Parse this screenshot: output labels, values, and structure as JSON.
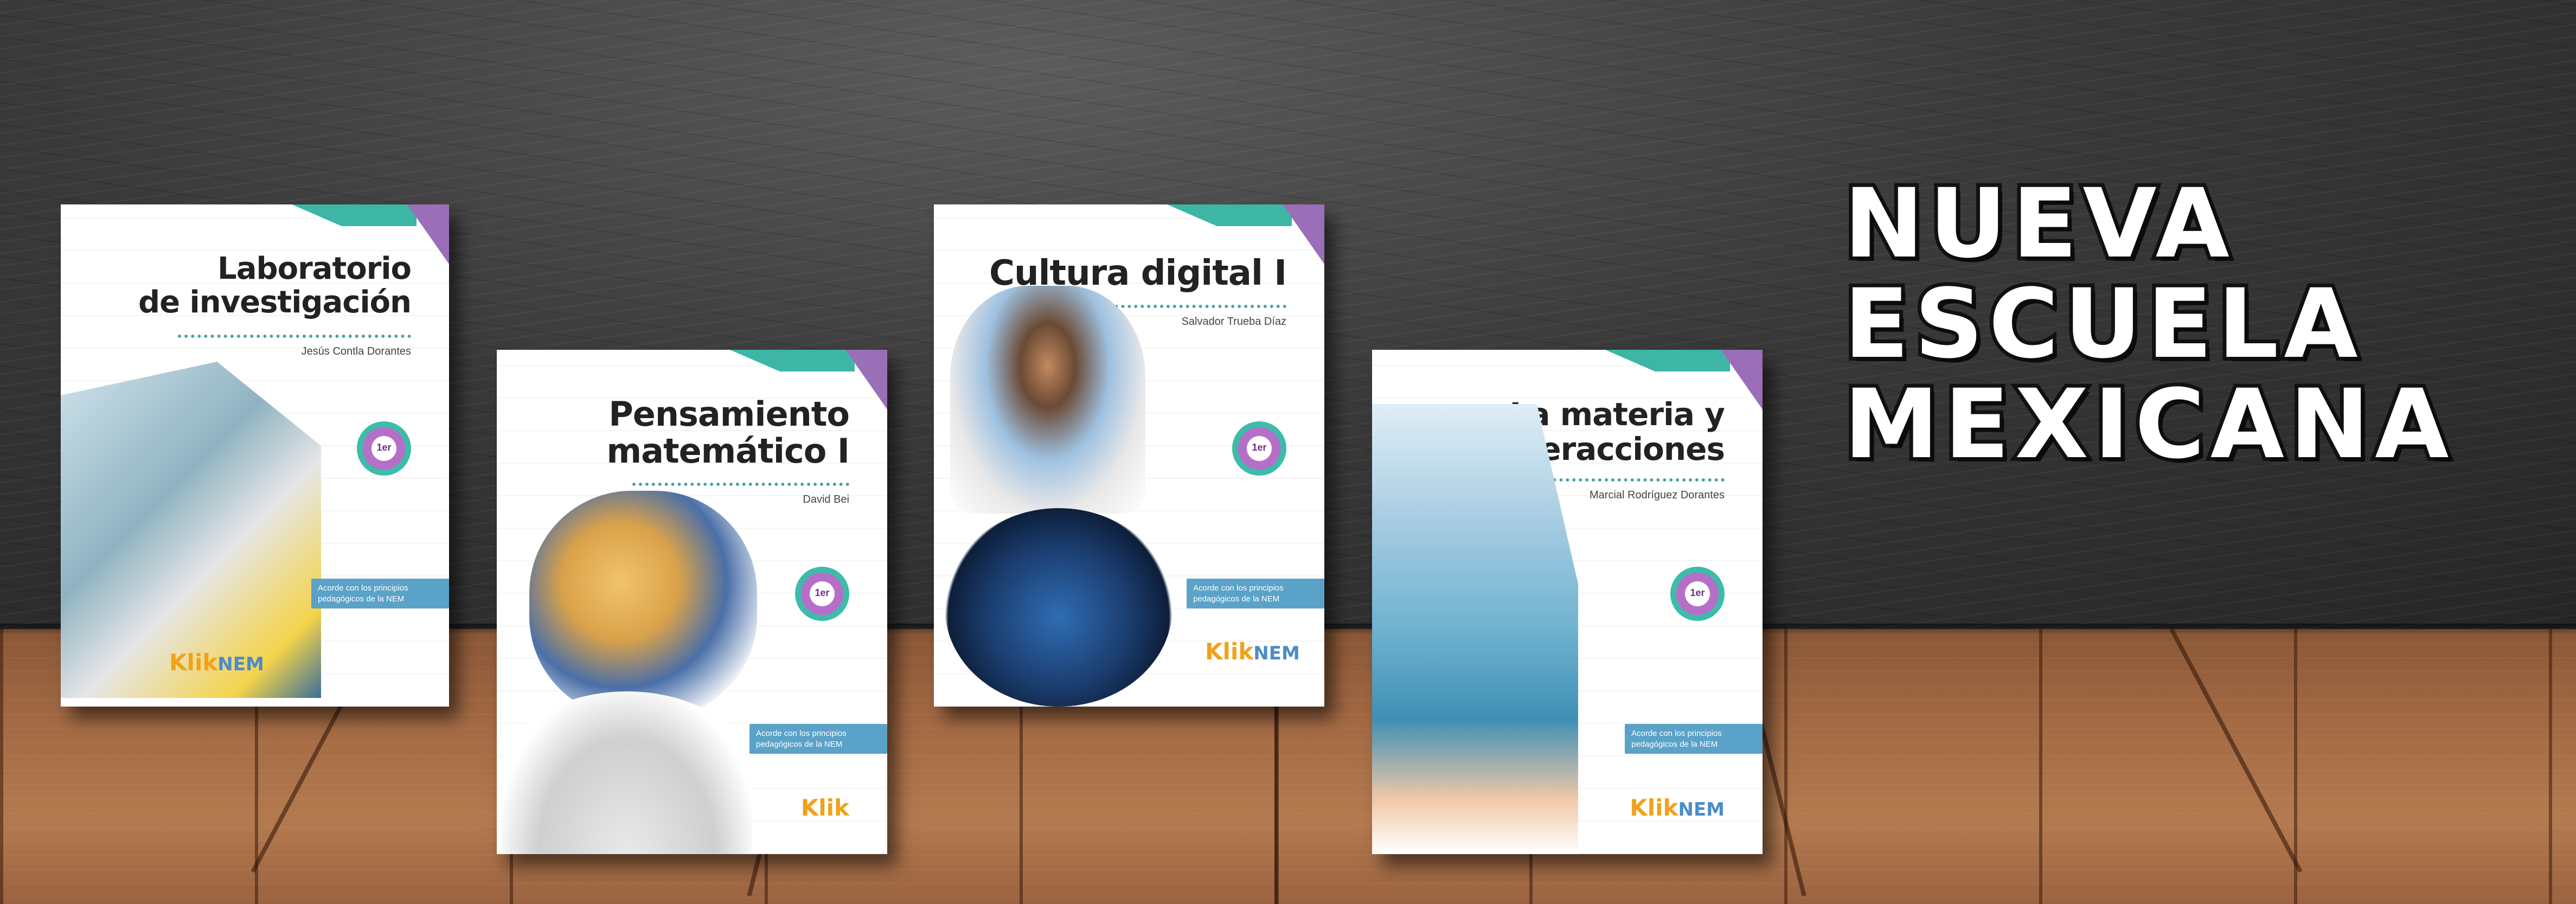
{
  "headline": {
    "line1": "NUEVA",
    "line2": "ESCUELA",
    "line3": "MEXICANA"
  },
  "books": [
    {
      "title_line1": "Laboratorio",
      "title_line2": "de investigación",
      "author": "Jesús Contla Dorantes",
      "badge": "1er",
      "nem_note": "Acorde con los principios pedagógicos de la NEM",
      "brand": "Klik",
      "brand_suffix": "NEM"
    },
    {
      "title_line1": "Pensamiento",
      "title_line2": "matemático I",
      "author": "David Bei",
      "badge": "1er",
      "nem_note": "Acorde con los principios pedagógicos de la NEM",
      "brand": "Klik",
      "brand_suffix": ""
    },
    {
      "title_line1": "Cultura digital I",
      "title_line2": "",
      "author": "Salvador Trueba Díaz",
      "badge": "1er",
      "nem_note": "Acorde con los principios pedagógicos de la NEM",
      "brand": "Klik",
      "brand_suffix": "NEM"
    },
    {
      "title_line1": "La materia y",
      "title_line2": "sus interacciones",
      "author": "Marcial Rodríguez Dorantes",
      "badge": "1er",
      "nem_note": "Acorde con los principios pedagógicos de la NEM",
      "brand": "Klik",
      "brand_suffix": "NEM"
    }
  ],
  "colors": {
    "teal": "#3db6a6",
    "purple": "#9a6fb8",
    "klik_orange": "#f2a11a",
    "nem_blue": "#4a8cc9"
  }
}
